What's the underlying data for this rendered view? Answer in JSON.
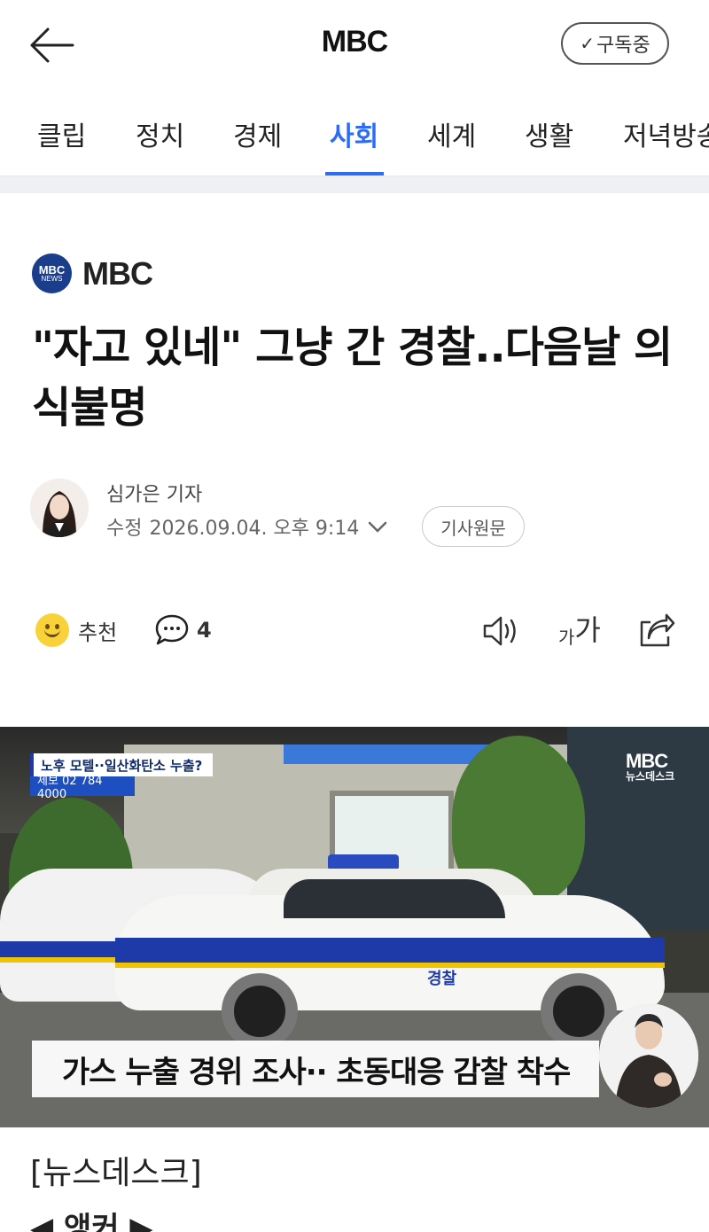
{
  "header": {
    "title": "MBC",
    "subscribe_label": "구독중"
  },
  "tabs": [
    {
      "label": "클립"
    },
    {
      "label": "정치"
    },
    {
      "label": "경제"
    },
    {
      "label": "사회",
      "active": true
    },
    {
      "label": "세계"
    },
    {
      "label": "생활"
    },
    {
      "label": "저녁방송"
    }
  ],
  "article": {
    "press_name": "MBC",
    "press_logo": {
      "line1": "MBC",
      "line2": "NEWS"
    },
    "headline": "\"자고 있네\" 그냥 간 경찰..다음날 의식불명",
    "reporter": "심가은 기자",
    "modified_label": "수정",
    "modified_time": "2026.09.04. 오후 9:14",
    "original_button": "기사원문"
  },
  "actions": {
    "like_label": "추천",
    "comment_count": "4",
    "font_small": "가",
    "font_large": "가"
  },
  "video": {
    "topbar": "노후 모텔··일산화탄소 누출?",
    "report": "제보 02 784 4000",
    "brand_a": "MBC",
    "brand_b": "뉴스데스크",
    "caption": "가스 누출 경위 조사·· 초동대응 감찰 착수",
    "car_label": "경찰"
  },
  "body": {
    "line1": "[뉴스데스크]",
    "line2": "◀ 앵커 ▶"
  },
  "colors": {
    "accent": "#2d6df6",
    "press_logo_bg": "#1b3e8c"
  }
}
